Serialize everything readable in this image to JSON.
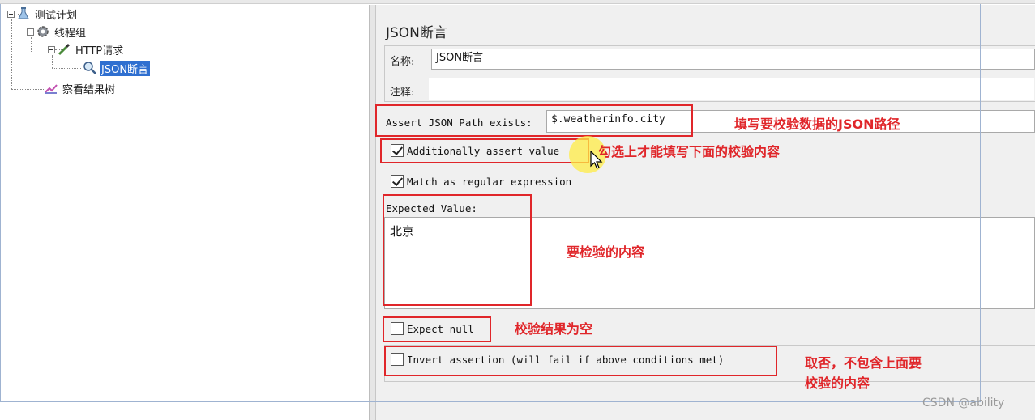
{
  "tree": {
    "test_plan": "测试计划",
    "thread_group": "线程组",
    "http_request": "HTTP请求",
    "json_assertion": "JSON断言",
    "results_tree": "察看结果树"
  },
  "panel": {
    "title": "JSON断言",
    "name_label": "名称:",
    "name_value": "JSON断言",
    "comment_label": "注释:",
    "comment_value": "",
    "json_path_label": "Assert JSON Path exists:",
    "json_path_value": "$.weatherinfo.city",
    "additionally_assert_label": "Additionally assert value",
    "additionally_assert_checked": true,
    "regex_label": "Match as regular expression",
    "regex_checked": true,
    "expected_value_label": "Expected Value:",
    "expected_value": "北京",
    "expect_null_label": "Expect null",
    "expect_null_checked": false,
    "invert_label": "Invert assertion (will fail if above conditions met)",
    "invert_checked": false
  },
  "annotations": {
    "json_path_note": "填写要校验数据的JSON路径",
    "additionally_note": "勾选上才能填写下面的校验内容",
    "expected_note": "要检验的内容",
    "null_note": "校验结果为空",
    "invert_note_line1": "取否，不包含上面要",
    "invert_note_line2": "校验的内容"
  },
  "watermark": "CSDN @ability",
  "colors": {
    "annotation_red": "#e0262a",
    "selection_blue": "#2f6fd0",
    "panel_bg": "#f0f0f0"
  }
}
